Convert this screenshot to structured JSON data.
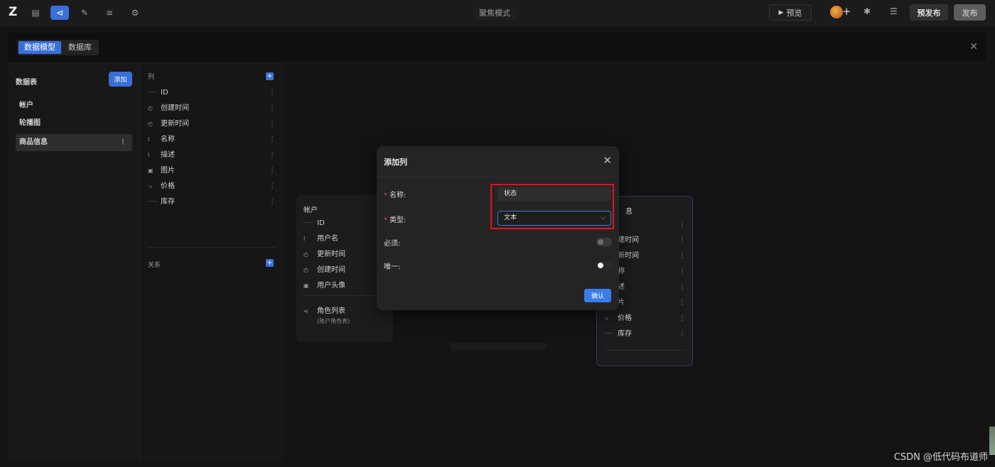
{
  "topbar": {
    "logo": "Z",
    "center_title": "聚焦模式",
    "preview_label": "预览",
    "prepublish_label": "预发布",
    "publish_label": "发布"
  },
  "panel": {
    "tabs": [
      {
        "label": "数据模型",
        "active": true
      },
      {
        "label": "数据库",
        "active": false
      }
    ]
  },
  "tables": {
    "title": "数据表",
    "add_label": "添加",
    "items": [
      {
        "label": "帐户"
      },
      {
        "label": "轮播图"
      },
      {
        "label": "商品信息"
      }
    ]
  },
  "columns": {
    "header": "列",
    "items": [
      {
        "icon": "id-icon",
        "label": "ID"
      },
      {
        "icon": "clock-icon",
        "label": "创建时间"
      },
      {
        "icon": "clock-icon",
        "label": "更新时间"
      },
      {
        "icon": "text-icon",
        "label": "名称"
      },
      {
        "icon": "text-icon",
        "label": "描述"
      },
      {
        "icon": "image-icon",
        "label": "图片"
      },
      {
        "icon": "number-icon",
        "label": "价格"
      },
      {
        "icon": "id-icon",
        "label": "库存"
      }
    ],
    "relations_header": "关系"
  },
  "canvas": {
    "account_card": {
      "title": "帐户",
      "rows": [
        {
          "icon": "id-icon",
          "label": "ID"
        },
        {
          "icon": "text-icon",
          "label": "用户名"
        },
        {
          "icon": "clock-icon",
          "label": "更新时间"
        },
        {
          "icon": "clock-icon",
          "label": "创建时间"
        },
        {
          "icon": "image-icon",
          "label": "用户头像"
        }
      ],
      "relation_title": "角色列表",
      "relation_sub": "(账户角色表)"
    },
    "product_card": {
      "title_fragment": "息",
      "rows": [
        {
          "label": ""
        },
        {
          "label": "建时间"
        },
        {
          "label": "新时间"
        },
        {
          "label": "称"
        },
        {
          "label": "述"
        },
        {
          "label": "片"
        },
        {
          "label": "价格"
        },
        {
          "label": "库存"
        }
      ]
    }
  },
  "modal": {
    "title": "添加列",
    "name_label": "名称:",
    "name_value": "状态",
    "type_label": "类型:",
    "type_value": "文本",
    "required_label": "必须:",
    "required_on": false,
    "unique_label": "唯一:",
    "unique_on": false,
    "confirm_label": "确认"
  },
  "watermark": "CSDN @低代码布道师",
  "colors": {
    "accent": "#3a6fd8",
    "highlight": "#e0141c",
    "required_mark": "#e84a4a"
  }
}
